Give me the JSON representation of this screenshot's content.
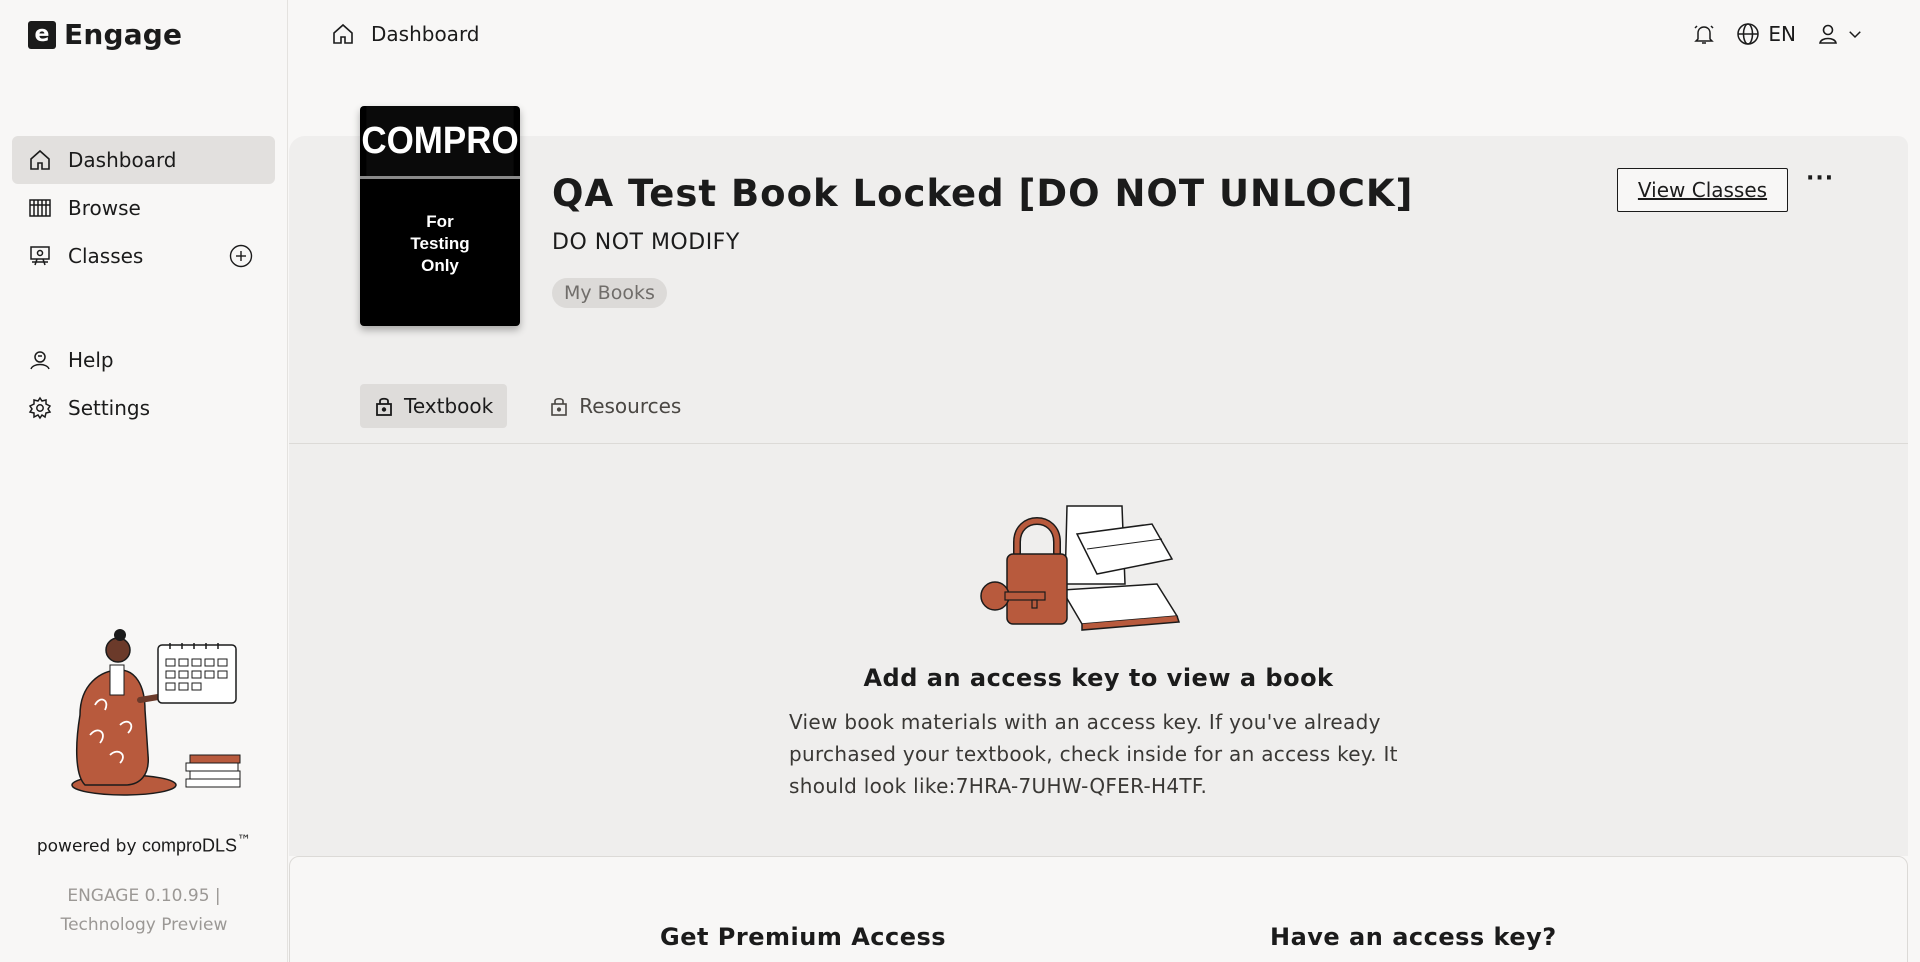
{
  "app": {
    "logo_letter": "e",
    "name": "Engage"
  },
  "sidebar": {
    "items": [
      {
        "label": "Dashboard",
        "icon": "home-icon",
        "active": true
      },
      {
        "label": "Browse",
        "icon": "books-icon"
      },
      {
        "label": "Classes",
        "icon": "classroom-icon"
      },
      {
        "label": "Help",
        "icon": "help-icon"
      },
      {
        "label": "Settings",
        "icon": "gear-icon"
      }
    ],
    "powered_prefix": "powered by ",
    "powered_brand": "comproDLS",
    "powered_tm": "™",
    "version_line1": "ENGAGE 0.10.95 |",
    "version_line2": "Technology Preview"
  },
  "topbar": {
    "breadcrumb": "Dashboard",
    "language": "EN"
  },
  "book": {
    "cover_brand": "COMPRO",
    "cover_line1": "For",
    "cover_line2": "Testing",
    "cover_line3": "Only",
    "title": "QA Test Book Locked [DO NOT UNLOCK]",
    "subtitle": "DO NOT MODIFY",
    "chip": "My Books",
    "view_classes": "View Classes",
    "more": "···",
    "tabs": [
      {
        "label": "Textbook",
        "active": true
      },
      {
        "label": "Resources"
      }
    ]
  },
  "locked": {
    "title": "Add an access key to view a book",
    "text": "View book materials with an access key. If you've already purchased your textbook, check inside for an access key. It should look like:7HRA-7UHW-QFER-H4TF."
  },
  "access": {
    "premium": "Get Premium Access",
    "have_key": "Have an access key?"
  },
  "colors": {
    "accent": "#b85a3d",
    "active_bg": "#e2e0de"
  }
}
